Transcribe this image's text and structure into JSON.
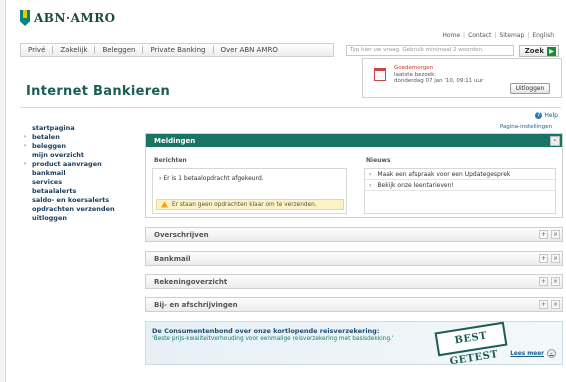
{
  "brand": {
    "name": "ABN·AMRO"
  },
  "toplinks": [
    "Home",
    "Contact",
    "Sitemap",
    "English"
  ],
  "mainnav": [
    "Privé",
    "Zakelijk",
    "Beleggen",
    "Private Banking",
    "Over ABN AMRO"
  ],
  "search": {
    "placeholder": "Typ hier uw vraag. Gebruik minimaal 2 woorden.",
    "button": "Zoek"
  },
  "header": {
    "title": "Internet Bankieren"
  },
  "greeting": {
    "hello": "Goedemorgen",
    "last_visit_label": "laatste bezoek:",
    "last_visit_value": "donderdag 07 jan '10, 09:11 uur",
    "logout": "Uitloggen"
  },
  "help": {
    "label": "Help",
    "page_settings": "Pagina-instellingen"
  },
  "sidebar": {
    "items": [
      {
        "label": "startpagina",
        "bullet": ""
      },
      {
        "label": "betalen",
        "bullet": "›"
      },
      {
        "label": "beleggen",
        "bullet": "›"
      },
      {
        "label": "mijn overzicht",
        "bullet": ""
      },
      {
        "label": "product aanvragen",
        "bullet": "›"
      },
      {
        "label": "bankmail",
        "bullet": ""
      },
      {
        "label": "services",
        "bullet": ""
      },
      {
        "label": "betaalalerts",
        "bullet": ""
      },
      {
        "label": "saldo- en koersalerts",
        "bullet": ""
      },
      {
        "label": "opdrachten verzenden",
        "bullet": ""
      },
      {
        "label": "uitloggen",
        "bullet": ""
      }
    ]
  },
  "meldingen": {
    "title": "Meldingen",
    "berichten_label": "Berichten",
    "bericht": "Er is 1 betaalopdracht afgekeurd.",
    "warning": "Er staan geen opdrachten klaar om te verzenden.",
    "nieuws_label": "Nieuws",
    "nieuws": [
      "Maak een afspraak voor een Updategesprek",
      "Bekijk onze leentarieven!"
    ]
  },
  "panels": [
    "Overschrijven",
    "Bankmail",
    "Rekeningoverzicht",
    "Bij- en afschrijvingen"
  ],
  "consument": {
    "title": "De Consumentenbond over onze kortlopende reisverzekering:",
    "subtitle": "'Beste prijs-kwaliteitverhouding voor eenmalige reisverzekering met basisdekking.'",
    "stamp": "BEST GETEST",
    "more": "Lees meer"
  }
}
